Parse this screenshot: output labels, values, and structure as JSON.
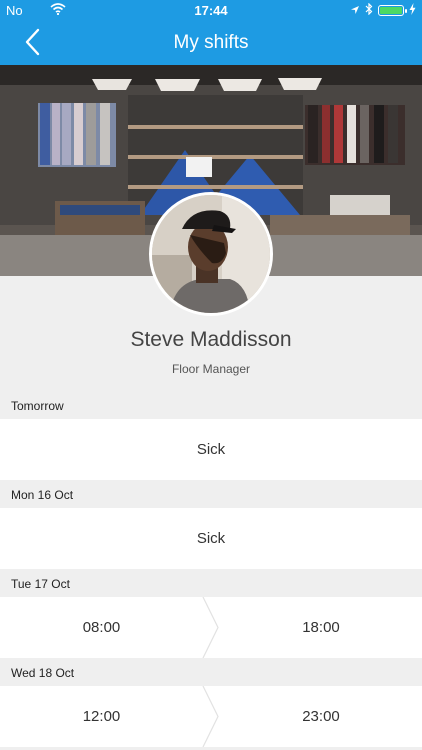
{
  "status_bar": {
    "carrier": "No",
    "time": "17:44"
  },
  "nav": {
    "title": "My shifts"
  },
  "profile": {
    "name": "Steve Maddisson",
    "role": "Floor Manager"
  },
  "shifts": [
    {
      "day": "Tomorrow",
      "status": "Sick"
    },
    {
      "day": "Mon 16 Oct",
      "status": "Sick"
    },
    {
      "day": "Tue 17 Oct",
      "start": "08:00",
      "end": "18:00"
    },
    {
      "day": "Wed 18 Oct",
      "start": "12:00",
      "end": "23:00"
    }
  ],
  "colors": {
    "accent": "#1e9be3",
    "background": "#efefef",
    "battery": "#4cd964"
  }
}
